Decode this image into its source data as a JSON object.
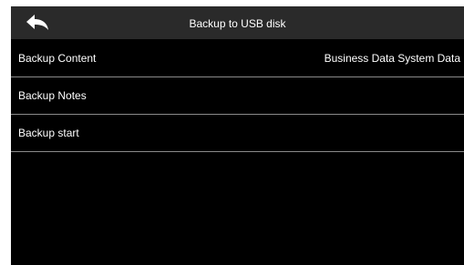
{
  "header": {
    "title": "Backup to USB disk",
    "back_icon": "back-arrow-icon"
  },
  "menu": {
    "items": [
      {
        "label": "Backup Content",
        "value": "Business Data System Data"
      },
      {
        "label": "Backup Notes",
        "value": ""
      },
      {
        "label": "Backup start",
        "value": ""
      }
    ]
  },
  "colors": {
    "background": "#000000",
    "titlebar": "#2a2a2a",
    "text": "#ffffff",
    "divider": "#8a8a8a"
  }
}
